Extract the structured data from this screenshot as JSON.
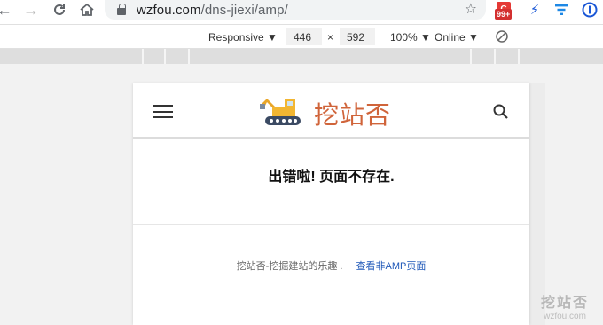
{
  "browser": {
    "url_host": "wzfou.com",
    "url_path": "/dns-jiexi/amp/",
    "ext_badge": "99+",
    "ext_red_label": "C"
  },
  "devbar": {
    "device": "Responsive ▼",
    "width": "446",
    "times": "×",
    "height": "592",
    "zoom": "100% ▼",
    "network": "Online ▼"
  },
  "site": {
    "brand": "挖站否",
    "error_title": "出错啦! 页面不存在.",
    "footer_text": "挖站否-挖掘建站的乐趣 .",
    "footer_link": "查看非AMP页面"
  },
  "watermark": {
    "name": "挖站否",
    "url": "wzfou.com"
  },
  "colors": {
    "brand": "#d0643a",
    "link": "#1e57b8"
  }
}
